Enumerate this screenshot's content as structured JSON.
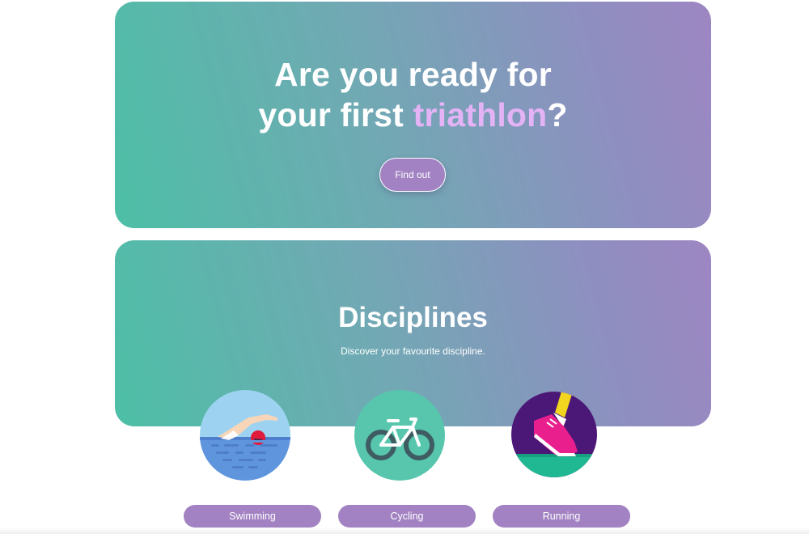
{
  "hero": {
    "title_line1": "Are you ready for",
    "title_line2_prefix": "your first ",
    "title_accent": "triathlon",
    "title_suffix": "?",
    "cta_label": "Find out"
  },
  "disciplines": {
    "title": "Disciplines",
    "subtitle": "Discover your favourite discipline.",
    "items": [
      {
        "label": "Swimming",
        "icon": "swimmer-icon"
      },
      {
        "label": "Cycling",
        "icon": "bicycle-icon"
      },
      {
        "label": "Running",
        "icon": "running-shoe-icon"
      }
    ]
  },
  "colors": {
    "gradient_start": "#4dbfa6",
    "gradient_end": "#9d86c2",
    "accent_text": "#e4b3f6",
    "button": "#a282c2"
  }
}
